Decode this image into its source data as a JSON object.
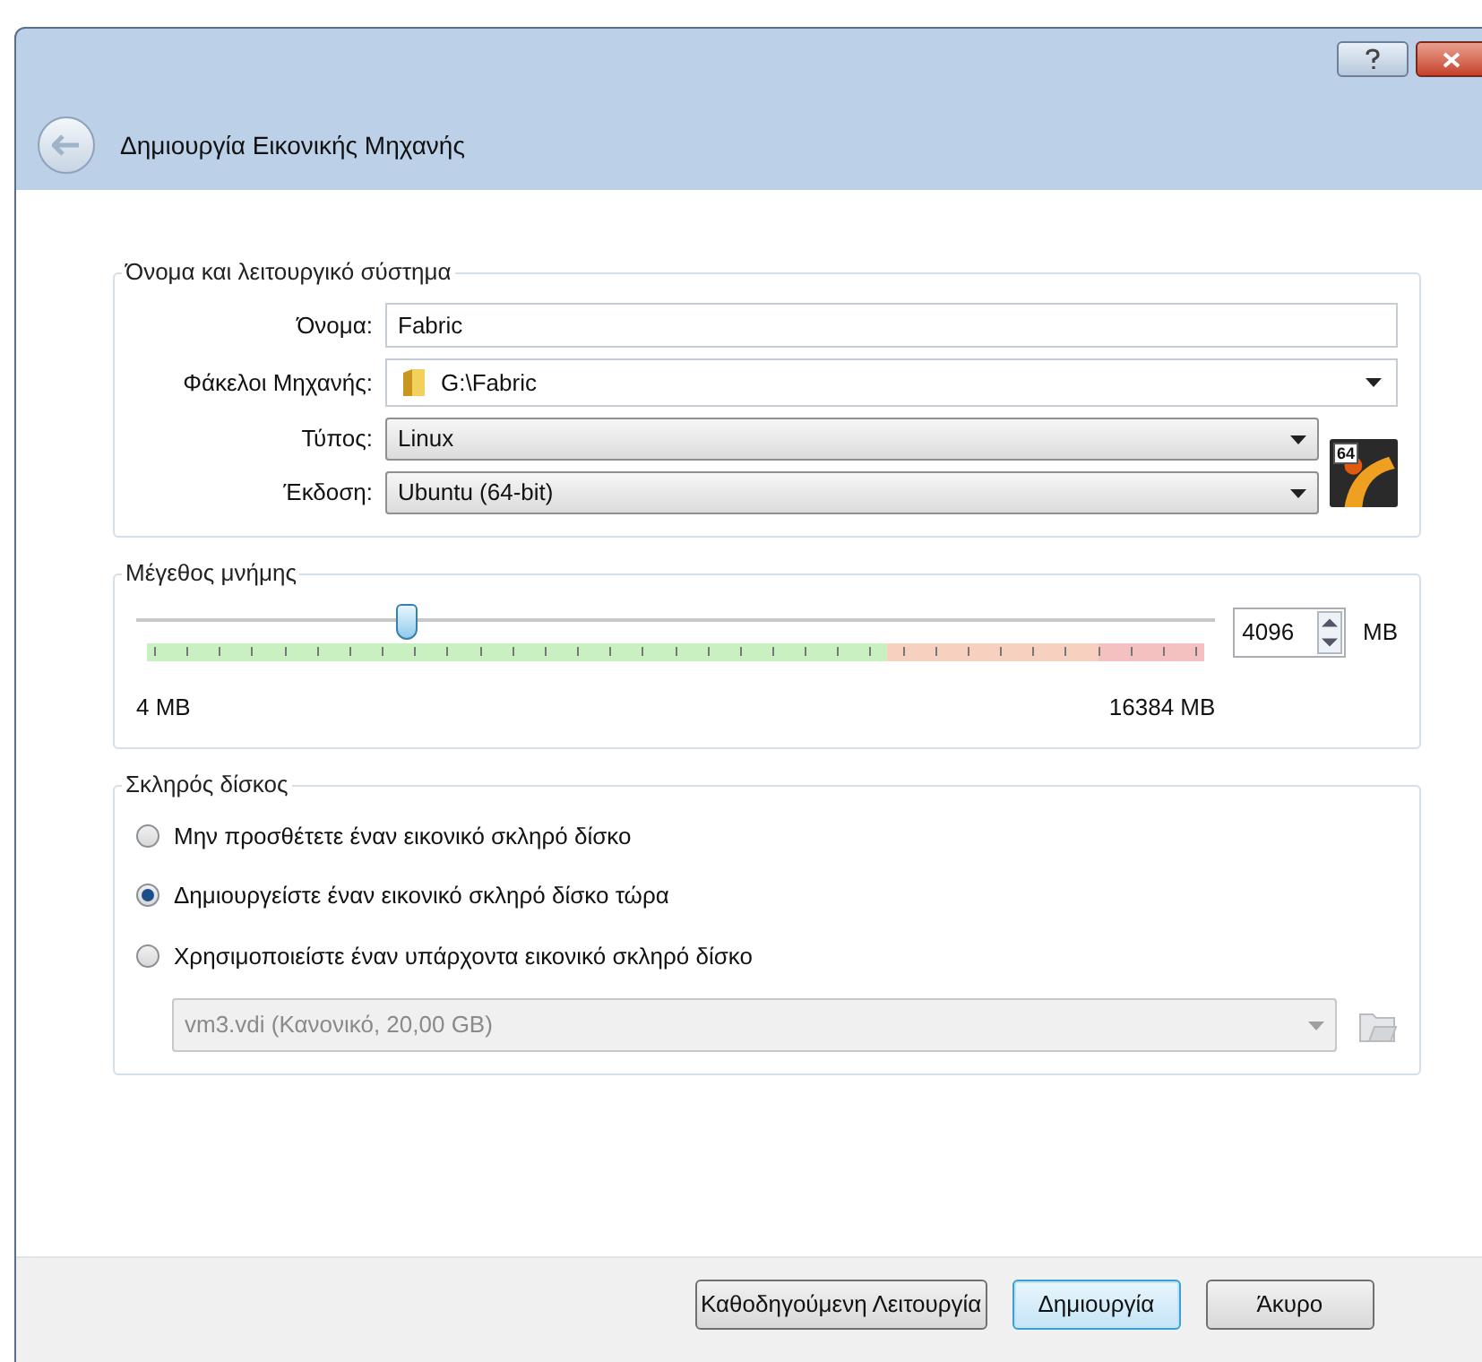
{
  "window": {
    "title": "Δημιουργία Εικονικής Μηχανής"
  },
  "name_os": {
    "title": "Όνομα και λειτουργικό σύστημα",
    "fields": [
      {
        "kind": "text",
        "label": "Όνομα:",
        "value": "Fabric"
      },
      {
        "kind": "folder",
        "label": "Φάκελοι Μηχανής:",
        "value": "G:\\Fabric"
      },
      {
        "kind": "combo",
        "label": "Τύπος:",
        "value": "Linux"
      },
      {
        "kind": "combo",
        "label": "Έκδοση:",
        "value": "Ubuntu (64-bit)"
      }
    ],
    "os_badge": "64"
  },
  "memory": {
    "title": "Μέγεθος μνήμης",
    "level": 0.25,
    "value": "4096",
    "unit": "MB",
    "min_label": "4 MB",
    "max_label": "16384 MB"
  },
  "disk": {
    "title": "Σκληρός δίσκος",
    "options": [
      {
        "label": "Μην προσθέτετε έναν εικονικό σκληρό δίσκο",
        "selected": false
      },
      {
        "label": "Δημιουργείστε έναν εικονικό σκληρό δίσκο τώρα",
        "selected": true
      },
      {
        "label": "Χρησιμοποιείστε έναν υπάρχοντα εικονικό σκληρό δίσκο",
        "selected": false
      }
    ],
    "existing": {
      "value": "vm3.vdi (Κανονικό, 20,00 GB)",
      "disabled": true
    }
  },
  "buttons": [
    {
      "label": "Καθοδηγούμενη Λειτουργία",
      "focused": false
    },
    {
      "label": "Δημιουργία",
      "focused": true
    },
    {
      "label": "Άκυρο",
      "focused": false
    }
  ]
}
